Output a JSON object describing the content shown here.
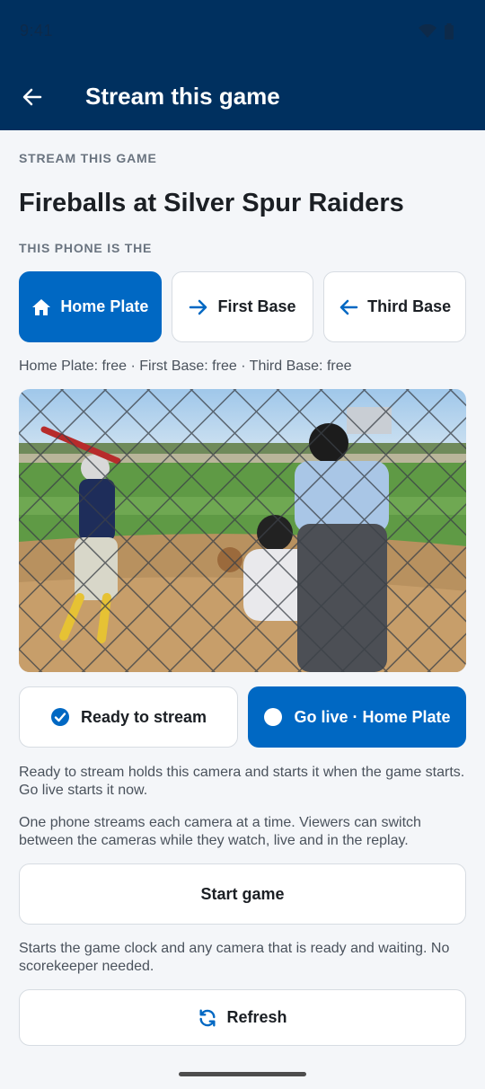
{
  "status_bar": {
    "time": "9:41",
    "wifi_icon": "wifi-icon",
    "battery_icon": "battery-icon"
  },
  "app_bar": {
    "title": "Stream this game",
    "back_icon": "arrow-left-icon"
  },
  "section_label": "STREAM THIS GAME",
  "game_title": "Fireballs at Silver Spur Raiders",
  "position_label": "THIS PHONE IS THE",
  "positions": [
    {
      "label": "Home Plate",
      "icon": "home-icon",
      "selected": true
    },
    {
      "label": "First Base",
      "icon": "arrow-right-icon",
      "selected": false
    },
    {
      "label": "Third Base",
      "icon": "arrow-left-icon",
      "selected": false
    }
  ],
  "occupancy": "Home Plate: free · First Base: free · Third Base: free",
  "preview": {
    "description_icon": "camera-preview"
  },
  "actions": {
    "ready_label": "Ready to stream",
    "ready_icon": "check-circle-icon",
    "live_label": "Go live · Home Plate",
    "live_icon": "live-dot-icon"
  },
  "help1": "Ready to stream holds this camera and starts it when the game starts. Go live starts it now.",
  "help2": "One phone streams each camera at a time. Viewers can switch between the cameras while they watch, live and in the replay.",
  "start_label": "Start game",
  "help3": "Starts the game clock and any camera that is ready and waiting. No scorekeeper needed.",
  "refresh_label": "Refresh",
  "colors": {
    "app_bar": "#00305f",
    "accent": "#0068c3",
    "background": "#f4f6f9"
  }
}
